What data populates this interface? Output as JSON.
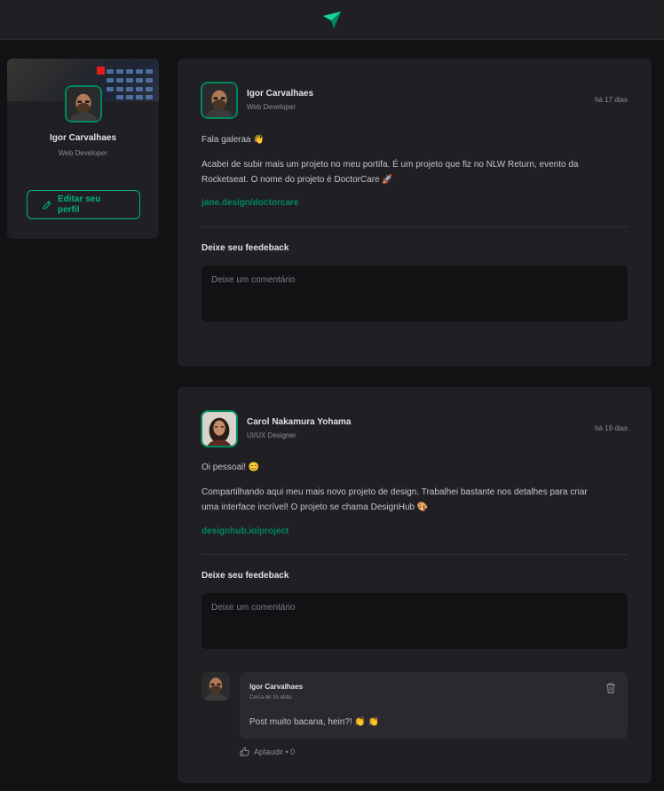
{
  "header": {
    "logo_icon": "ignite-feed-logo-icon"
  },
  "colors": {
    "accent": "#00b37e",
    "accent_dark": "#00875f",
    "background": "#121214",
    "surface": "#202024"
  },
  "sidebar": {
    "name": "Igor Carvalhaes",
    "role": "Web Developer",
    "edit_label": "Editar seu perfil"
  },
  "posts": [
    {
      "author": {
        "name": "Igor Carvalhaes",
        "role": "Web Developer"
      },
      "time": "há 17 dias",
      "content": [
        "Fala galeraa 👋",
        "Acabei de subir mais um projeto no meu portifa. É um projeto que fiz no NLW Return, evento da",
        "Rocketseat. O nome do projeto é DoctorCare 🚀"
      ],
      "link": "jane.design/doctorcare",
      "feedback_label": "Deixe seu feedeback",
      "comment_placeholder": "Deixe um comentário"
    },
    {
      "author": {
        "name": "Carol Nakamura Yohama",
        "role": "UI/UX Designer"
      },
      "time": "há 19 dias",
      "content": [
        "Oi pessoal! 😊",
        "Compartilhando aqui meu mais novo projeto de design. Trabalhei bastante nos detalhes para criar",
        "uma interface incrível! O projeto se chama DesignHub 🎨"
      ],
      "link": "designhub.io/project",
      "feedback_label": "Deixe seu feedeback",
      "comment_placeholder": "Deixe um comentário",
      "comments": [
        {
          "author": "Igor Carvalhaes",
          "time": "Cerca de 1h atrás",
          "text": "Post muito bacana, hein?! 👏 👏",
          "applause_label": "Aplaudir • 0"
        }
      ]
    }
  ]
}
